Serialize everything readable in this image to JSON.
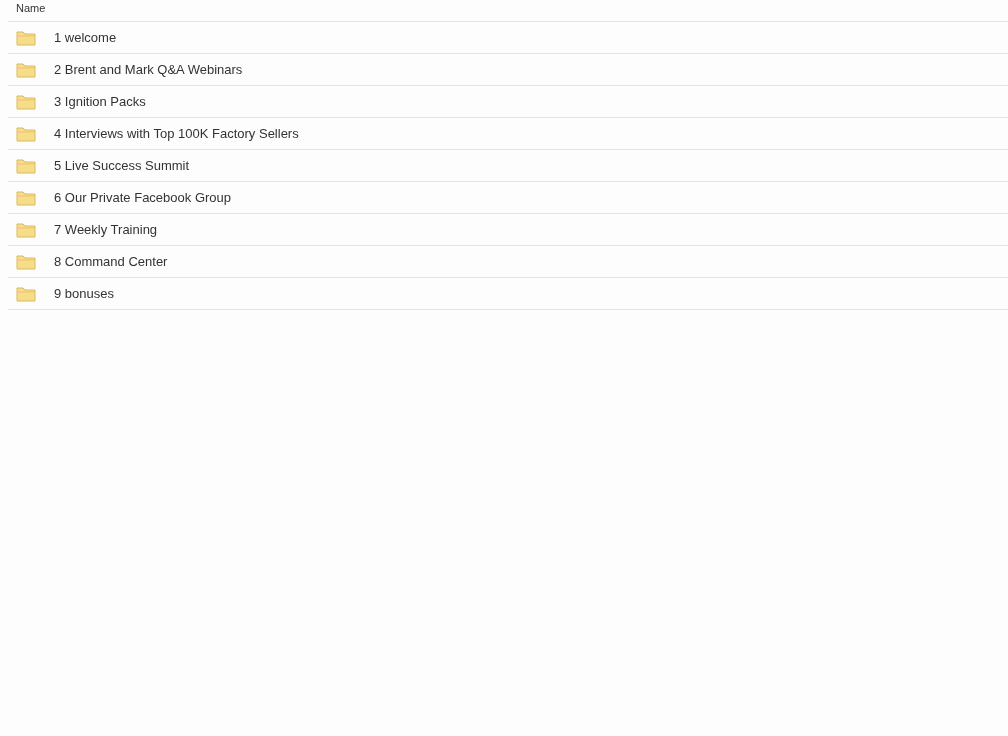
{
  "table": {
    "columns": [
      "Name"
    ],
    "rows": [
      {
        "name": "1 welcome"
      },
      {
        "name": "2 Brent and Mark Q&A Webinars"
      },
      {
        "name": "3 Ignition Packs"
      },
      {
        "name": "4 Interviews with Top 100K Factory Sellers"
      },
      {
        "name": "5 Live Success Summit"
      },
      {
        "name": "6 Our Private Facebook Group"
      },
      {
        "name": "7 Weekly Training"
      },
      {
        "name": "8 Command Center"
      },
      {
        "name": "9 bonuses"
      }
    ]
  }
}
